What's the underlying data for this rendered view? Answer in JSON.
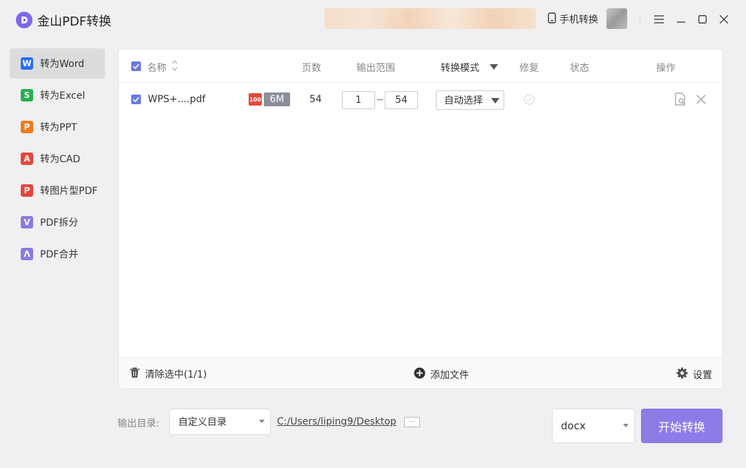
{
  "app": {
    "title": "金山PDF转换"
  },
  "header": {
    "phone_convert": "手机转换"
  },
  "sidebar": {
    "items": [
      {
        "label": "转为Word",
        "icon": "word-icon",
        "color": "#2b6cf6",
        "glyph": "W",
        "active": true
      },
      {
        "label": "转为Excel",
        "icon": "excel-icon",
        "color": "#22b14c",
        "glyph": "S",
        "active": false
      },
      {
        "label": "转为PPT",
        "icon": "ppt-icon",
        "color": "#f07c1a",
        "glyph": "P",
        "active": false
      },
      {
        "label": "转为CAD",
        "icon": "cad-icon",
        "color": "#e8453c",
        "glyph": "A",
        "active": false
      },
      {
        "label": "转图片型PDF",
        "icon": "image-pdf-icon",
        "color": "#e8453c",
        "glyph": "P",
        "active": false
      },
      {
        "label": "PDF拆分",
        "icon": "split-icon",
        "color": "#8a7be4",
        "glyph": "V",
        "active": false
      },
      {
        "label": "PDF合并",
        "icon": "merge-icon",
        "color": "#8a7be4",
        "glyph": "Λ",
        "active": false
      }
    ]
  },
  "table": {
    "headers": {
      "name": "名称",
      "pages": "页数",
      "range": "输出范围",
      "mode": "转换模式",
      "repair": "修复",
      "status": "状态",
      "actions": "操作"
    },
    "rows": [
      {
        "filename": "WPS+....pdf",
        "badge": "100",
        "size": "6M",
        "pages": "54",
        "range_from": "1",
        "range_to": "54",
        "mode": "自动选择"
      }
    ]
  },
  "footer": {
    "clear_label": "清除选中(1/1)",
    "add_label": "添加文件",
    "settings_label": "设置"
  },
  "output": {
    "label": "输出目录:",
    "dir_mode": "自定义目录",
    "path": "C:/Users/liping9/Desktop",
    "more": "···",
    "format": "docx",
    "start_label": "开始转换"
  },
  "colors": {
    "accent": "#8c7ce8",
    "checkbox": "#6c7ae0"
  }
}
